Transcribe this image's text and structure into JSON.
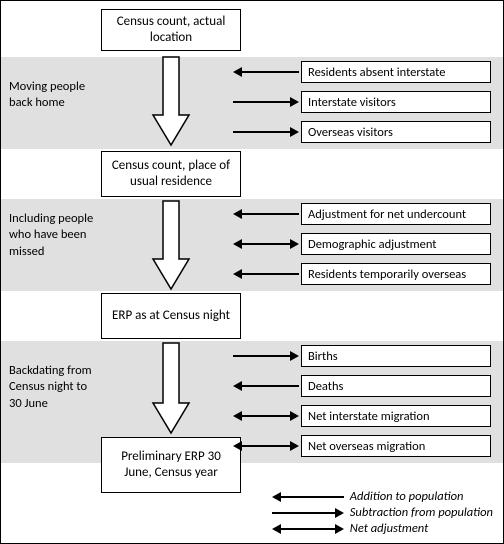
{
  "main_boxes": {
    "m1": "Census count, actual location",
    "m2": "Census count, place of usual residence",
    "m3": "ERP as at Census night",
    "m4": "Preliminary ERP 30 June, Census year"
  },
  "sections": {
    "s1": {
      "label": "Moving people back home",
      "adjustments": [
        {
          "text": "Residents absent interstate",
          "dir": "addition"
        },
        {
          "text": "Interstate visitors",
          "dir": "subtraction"
        },
        {
          "text": "Overseas visitors",
          "dir": "subtraction"
        }
      ]
    },
    "s2": {
      "label": "Including people who have been missed",
      "adjustments": [
        {
          "text": "Adjustment for net undercount",
          "dir": "addition"
        },
        {
          "text": "Demographic adjustment",
          "dir": "net"
        },
        {
          "text": "Residents temporarily overseas",
          "dir": "addition"
        }
      ]
    },
    "s3": {
      "label": "Backdating from Census night to 30 June",
      "adjustments": [
        {
          "text": "Births",
          "dir": "subtraction"
        },
        {
          "text": "Deaths",
          "dir": "addition"
        },
        {
          "text": "Net interstate migration",
          "dir": "net"
        },
        {
          "text": "Net overseas migration",
          "dir": "net"
        }
      ]
    }
  },
  "legend": {
    "addition": "Addition to population",
    "subtraction": "Subtraction from population",
    "net": "Net adjustment"
  }
}
